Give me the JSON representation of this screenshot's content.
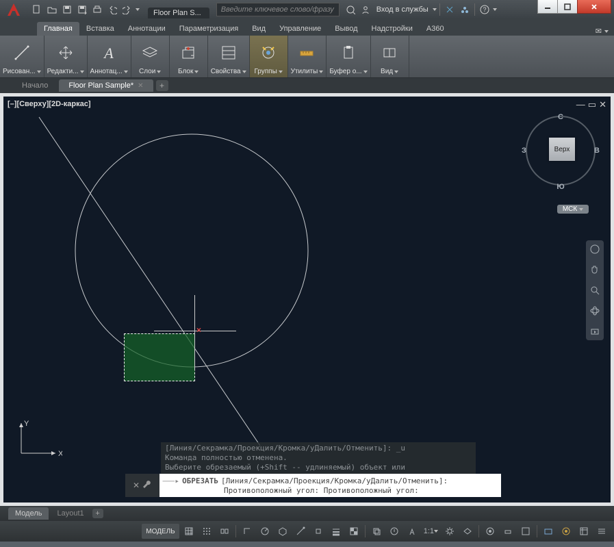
{
  "title_tab": "Floor Plan S...",
  "search_placeholder": "Введите ключевое слово/фразу",
  "signin_label": "Вход в службы",
  "ribbon_tabs": [
    "Главная",
    "Вставка",
    "Аннотации",
    "Параметризация",
    "Вид",
    "Управление",
    "Вывод",
    "Надстройки",
    "A360"
  ],
  "ribbon_active_index": 0,
  "panels": {
    "draw": "Рисован...",
    "edit": "Редакти...",
    "annotate": "Аннотац...",
    "layers": "Слои",
    "block": "Блок",
    "properties": "Свойства",
    "groups": "Группы",
    "utilities": "Утилиты",
    "clipboard": "Буфер о...",
    "view": "Вид"
  },
  "filetabs": {
    "start": "Начало",
    "doc": "Floor Plan Sample*"
  },
  "viewport_label": "[–][Сверху][2D-каркас]",
  "viewcube": {
    "top": "Верх",
    "n": "С",
    "s": "Ю",
    "w": "З",
    "e": "В"
  },
  "ucs_label": "МСК",
  "ucs_axes": {
    "x": "X",
    "y": "Y"
  },
  "cmd_history": [
    "[Линия/Секрамка/Проекция/Кромка/уДалить/Отменить]: _u",
    "Команда полностью отменена.",
    "Выберите обрезаемый (+Shift -- удлиняемый) объект или"
  ],
  "cmd_current_name": "ОБРЕЗАТЬ",
  "cmd_current_prompt_line1": "[Линия/Секрамка/Проекция/Кромка/уДалить/Отменить]:",
  "cmd_current_prompt_line2": "Противоположный угол: Противоположный угол:",
  "layout_tabs": {
    "model": "Модель",
    "layout1": "Layout1"
  },
  "status": {
    "model": "МОДЕЛЬ",
    "scale": "1:1"
  }
}
